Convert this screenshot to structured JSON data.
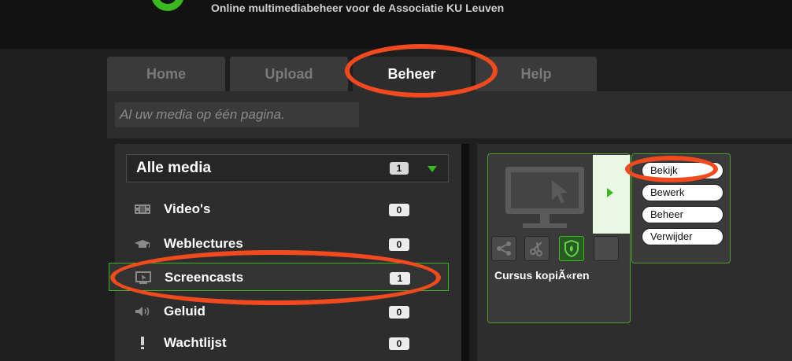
{
  "header": {
    "tagline": "Online multimediabeheer voor de Associatie KU Leuven"
  },
  "tabs": [
    {
      "label": "Home"
    },
    {
      "label": "Upload"
    },
    {
      "label": "Beheer"
    },
    {
      "label": "Help"
    }
  ],
  "active_tab": "Beheer",
  "subtitle": "Al uw media op één pagina.",
  "filter": {
    "label": "Alle media",
    "count": "1"
  },
  "categories": [
    {
      "label": "Video's",
      "count": "0",
      "icon": "film-icon"
    },
    {
      "label": "Weblectures",
      "count": "0",
      "icon": "graduation-cap-icon"
    },
    {
      "label": "Screencasts",
      "count": "1",
      "icon": "screencast-icon"
    },
    {
      "label": "Geluid",
      "count": "0",
      "icon": "speaker-icon"
    },
    {
      "label": "Wachtlijst",
      "count": "0",
      "icon": "exclamation-icon"
    }
  ],
  "selected_category": "Screencasts",
  "media_item": {
    "title": "Cursus kopiÃ«ren",
    "icons": [
      "share-icon",
      "scissors-icon",
      "shield-icon",
      "blank-icon"
    ]
  },
  "actions": [
    {
      "label": "Bekijk"
    },
    {
      "label": "Bewerk"
    },
    {
      "label": "Beheer"
    },
    {
      "label": "Verwijder"
    }
  ],
  "colors": {
    "accent": "#3ab81f",
    "annotation": "#f04a1e",
    "background": "#1e1e1e"
  }
}
